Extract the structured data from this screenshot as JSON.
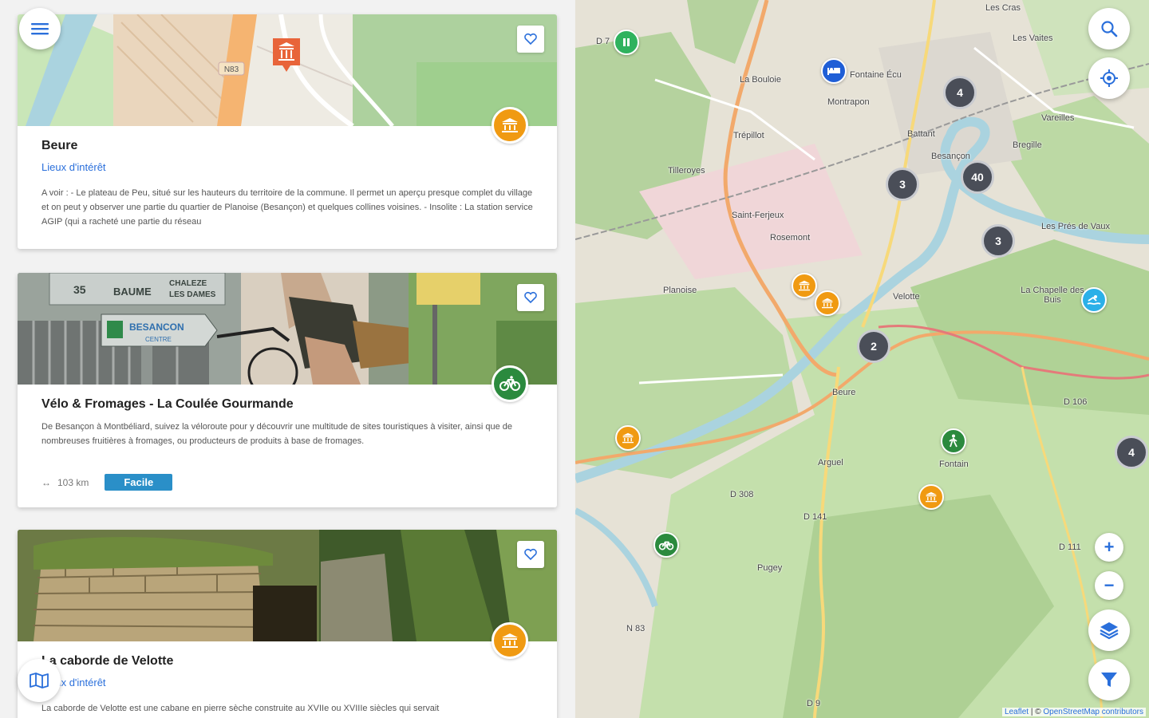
{
  "list": {
    "cards": [
      {
        "title": "Beure",
        "category": "Lieux d'intérêt",
        "description": "A voir : - Le plateau de Peu, situé sur les hauteurs du territoire de la commune. Il permet un aperçu presque complet du village et on peut y observer une partie du quartier de Planoise (Besançon) et quelques collines voisines. - Insolite : La station service AGIP (qui a racheté une partie du réseau",
        "map_label": "N83",
        "badge_icon": "museum-icon",
        "badge_color": "#f09a12"
      },
      {
        "title": "Vélo & Fromages - La Coulée Gourmande",
        "description": "De Besançon à Montbéliard, suivez la véloroute pour y découvrir une multitude de sites touristiques à visiter, ainsi que de nombreuses fruitières à fromages, ou producteurs de produits à base de fromages.",
        "distance_icon": "↔",
        "distance": "103 km",
        "difficulty": "Facile",
        "sign_line1": "35",
        "sign_line2": "BAUME",
        "sign_line3": "CHALEZE",
        "sign_line4": "LES DAMES",
        "sign_line5": "BESANCON",
        "sign_line6": "CENTRE",
        "badge_icon": "bicycle-icon",
        "badge_color": "#2b8a3e"
      },
      {
        "title": "La caborde de Velotte",
        "category": "Lieux d'intérêt",
        "description": "La caborde de Velotte est une cabane en pierre sèche construite au XVIIe ou XVIIIe siècles qui servait",
        "badge_icon": "museum-icon",
        "badge_color": "#f09a12"
      }
    ]
  },
  "map": {
    "labels": [
      {
        "text": "Les Cras"
      },
      {
        "text": "Les Vaites"
      },
      {
        "text": "La Bouloie"
      },
      {
        "text": "Fontaine Écu"
      },
      {
        "text": "Montrapon"
      },
      {
        "text": "Trépillot"
      },
      {
        "text": "Battant"
      },
      {
        "text": "Besançon"
      },
      {
        "text": "Bregille"
      },
      {
        "text": "Vareilles"
      },
      {
        "text": "Tilleroyes"
      },
      {
        "text": "Saint-Ferjeux"
      },
      {
        "text": "Rosemont"
      },
      {
        "text": "Planoise"
      },
      {
        "text": "Velotte"
      },
      {
        "text": "La Chapelle des Buis"
      },
      {
        "text": "Les Prés de Vaux"
      },
      {
        "text": "Beure"
      },
      {
        "text": "Fontain"
      },
      {
        "text": "Arguel"
      },
      {
        "text": "Pugey"
      },
      {
        "text": "D 106"
      },
      {
        "text": "D 308"
      },
      {
        "text": "D 141"
      },
      {
        "text": "D 111"
      },
      {
        "text": "N 83"
      },
      {
        "text": "D 9"
      },
      {
        "text": "D 7"
      }
    ],
    "clusters": [
      {
        "count": "4"
      },
      {
        "count": "3"
      },
      {
        "count": "40"
      },
      {
        "count": "3"
      },
      {
        "count": "2"
      },
      {
        "count": "4"
      }
    ],
    "pois": [
      {
        "icon": "parking-icon",
        "color": "#2fb25e"
      },
      {
        "icon": "bed-icon",
        "color": "#1f5ed6"
      },
      {
        "icon": "museum-icon",
        "color": "#f09a12"
      },
      {
        "icon": "museum-icon",
        "color": "#f09a12"
      },
      {
        "icon": "swimming-icon",
        "color": "#2bb0e8"
      },
      {
        "icon": "museum-icon",
        "color": "#f09a12"
      },
      {
        "icon": "hiking-icon",
        "color": "#2b8a3e"
      },
      {
        "icon": "museum-icon",
        "color": "#f09a12"
      },
      {
        "icon": "bicycle-icon",
        "color": "#2b8a3e"
      }
    ],
    "controls": {
      "zoom_in": "+",
      "zoom_out": "−"
    },
    "attribution": {
      "leaflet": "Leaflet",
      "sep": " | © ",
      "osm": "OpenStreetMap contributors"
    }
  }
}
